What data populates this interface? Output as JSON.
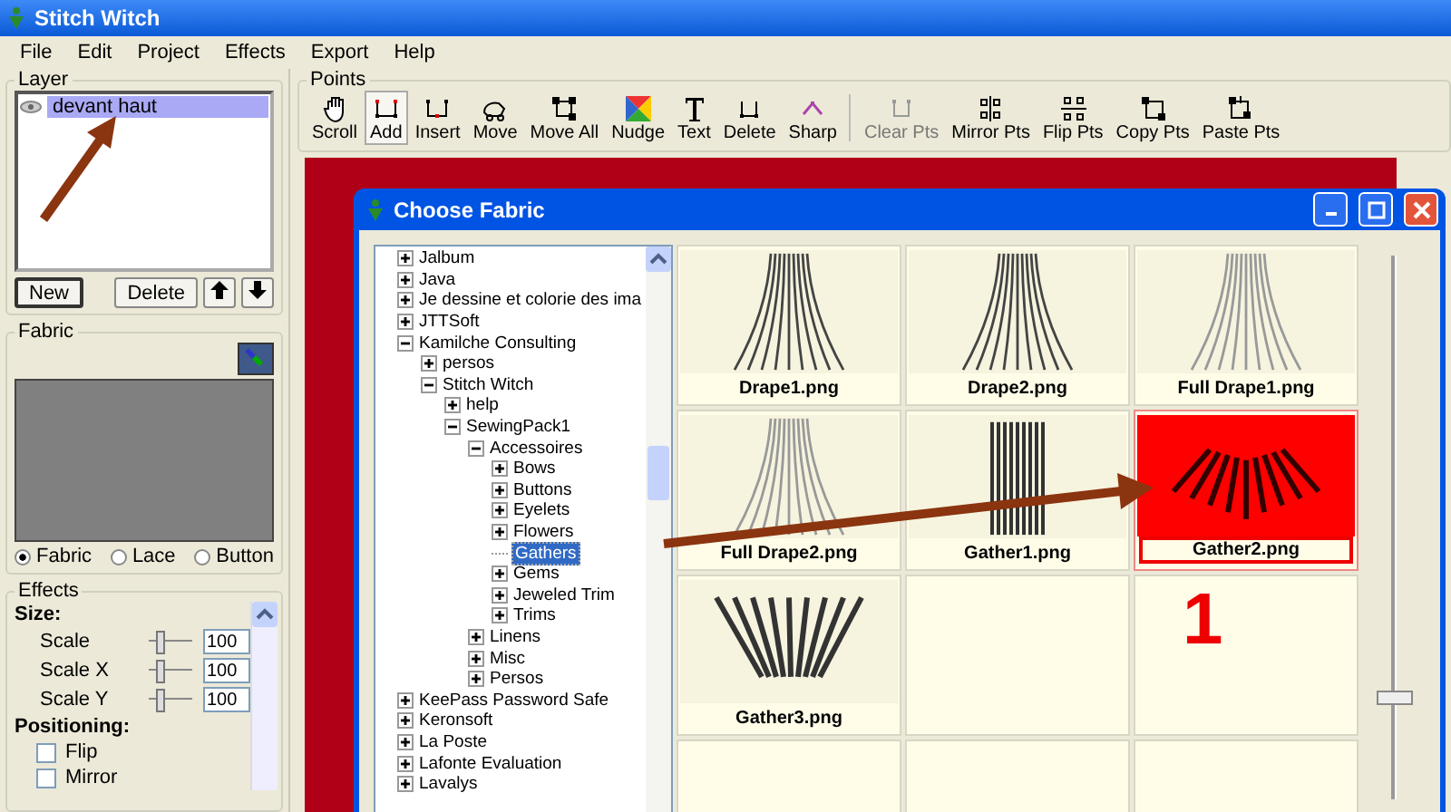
{
  "window": {
    "title": "Stitch Witch"
  },
  "menu": [
    "File",
    "Edit",
    "Project",
    "Effects",
    "Export",
    "Help"
  ],
  "layer_panel": {
    "title": "Layer",
    "layers": [
      {
        "name": "devant haut",
        "selected": true
      }
    ],
    "buttons": [
      "New",
      "Delete"
    ]
  },
  "fabric_panel": {
    "title": "Fabric",
    "types": [
      {
        "label": "Fabric",
        "selected": true
      },
      {
        "label": "Lace",
        "selected": false
      },
      {
        "label": "Button",
        "selected": false
      }
    ]
  },
  "effects_panel": {
    "title": "Effects",
    "sections": [
      {
        "heading": "Size:",
        "rows": [
          {
            "kind": "slider",
            "label": "Scale",
            "level": 0.25,
            "value": "100"
          },
          {
            "kind": "slider",
            "label": "Scale X",
            "level": 0.25,
            "value": "100"
          },
          {
            "kind": "slider",
            "label": "Scale Y",
            "level": 0.25,
            "value": "100"
          }
        ]
      },
      {
        "heading": "Positioning:",
        "rows": [
          {
            "kind": "checkbox",
            "label": "Flip",
            "checked": false
          },
          {
            "kind": "checkbox",
            "label": "Mirror",
            "checked": false
          }
        ]
      }
    ]
  },
  "toolbar": {
    "title": "Points",
    "tools": [
      {
        "kind": "hand",
        "label": "Scroll",
        "selected": false,
        "disabled": false
      },
      {
        "kind": "add",
        "label": "Add",
        "selected": true,
        "disabled": false
      },
      {
        "kind": "insert",
        "label": "Insert",
        "selected": false,
        "disabled": false
      },
      {
        "kind": "move",
        "label": "Move",
        "selected": false,
        "disabled": false
      },
      {
        "kind": "move-all",
        "label": "Move All",
        "selected": false,
        "disabled": false
      },
      {
        "kind": "nudge",
        "label": "Nudge",
        "selected": false,
        "disabled": false
      },
      {
        "kind": "text",
        "label": "Text",
        "selected": false,
        "disabled": false
      },
      {
        "kind": "delete",
        "label": "Delete",
        "selected": false,
        "disabled": false
      },
      {
        "kind": "sharp",
        "label": "Sharp",
        "selected": false,
        "disabled": false
      },
      {
        "kind": "clear",
        "label": "Clear Pts",
        "selected": false,
        "disabled": true
      },
      {
        "kind": "mirror",
        "label": "Mirror Pts",
        "selected": false,
        "disabled": false
      },
      {
        "kind": "flip",
        "label": "Flip Pts",
        "selected": false,
        "disabled": false
      },
      {
        "kind": "copy",
        "label": "Copy Pts",
        "selected": false,
        "disabled": false
      },
      {
        "kind": "paste",
        "label": "Paste Pts",
        "selected": false,
        "disabled": false
      }
    ]
  },
  "dialog": {
    "title": "Choose Fabric",
    "tree": [
      {
        "label": "Jalbum",
        "kind": "folder",
        "expanded": false,
        "selected": false
      },
      {
        "label": "Java",
        "kind": "folder",
        "expanded": false,
        "selected": false
      },
      {
        "label": "Je dessine et colorie des ima",
        "kind": "folder",
        "expanded": false,
        "selected": false
      },
      {
        "label": "JTTSoft",
        "kind": "folder",
        "expanded": false,
        "selected": false
      },
      {
        "label": "Kamilche Consulting",
        "kind": "folder",
        "expanded": true,
        "selected": false,
        "children": [
          {
            "label": "persos",
            "kind": "folder",
            "expanded": false,
            "selected": false
          },
          {
            "label": "Stitch Witch",
            "kind": "folder",
            "expanded": true,
            "selected": false,
            "children": [
              {
                "label": "help",
                "kind": "folder",
                "expanded": false,
                "selected": false
              },
              {
                "label": "SewingPack1",
                "kind": "folder",
                "expanded": true,
                "selected": false,
                "children": [
                  {
                    "label": "Accessoires",
                    "kind": "folder",
                    "expanded": true,
                    "selected": false,
                    "children": [
                      {
                        "label": "Bows",
                        "kind": "folder",
                        "expanded": false,
                        "selected": false
                      },
                      {
                        "label": "Buttons",
                        "kind": "folder",
                        "expanded": false,
                        "selected": false
                      },
                      {
                        "label": "Eyelets",
                        "kind": "folder",
                        "expanded": false,
                        "selected": false
                      },
                      {
                        "label": "Flowers",
                        "kind": "folder",
                        "expanded": false,
                        "selected": false
                      },
                      {
                        "label": "Gathers",
                        "kind": "item",
                        "selected": true
                      },
                      {
                        "label": "Gems",
                        "kind": "folder",
                        "expanded": false,
                        "selected": false
                      },
                      {
                        "label": "Jeweled Trim",
                        "kind": "folder",
                        "expanded": false,
                        "selected": false
                      },
                      {
                        "label": "Trims",
                        "kind": "folder",
                        "expanded": false,
                        "selected": false
                      }
                    ]
                  },
                  {
                    "label": "Linens",
                    "kind": "folder",
                    "expanded": false,
                    "selected": false
                  },
                  {
                    "label": "Misc",
                    "kind": "folder",
                    "expanded": false,
                    "selected": false
                  },
                  {
                    "label": "Persos",
                    "kind": "folder",
                    "expanded": false,
                    "selected": false
                  }
                ]
              }
            ]
          }
        ]
      },
      {
        "label": "KeePass Password Safe",
        "kind": "folder",
        "expanded": false,
        "selected": false
      },
      {
        "label": "Keronsoft",
        "kind": "folder",
        "expanded": false,
        "selected": false
      },
      {
        "label": "La Poste",
        "kind": "folder",
        "expanded": false,
        "selected": false
      },
      {
        "label": "Lafonte Evaluation",
        "kind": "folder",
        "expanded": false,
        "selected": false
      },
      {
        "label": "Lavalys",
        "kind": "folder",
        "expanded": false,
        "selected": false
      }
    ],
    "thumbnails": [
      {
        "kind": "drape",
        "label": "Drape1.png",
        "selected": false
      },
      {
        "kind": "drape",
        "label": "Drape2.png",
        "selected": false
      },
      {
        "kind": "full-drape",
        "label": "Full Drape1.png",
        "selected": false
      },
      {
        "kind": "full-drape",
        "label": "Full Drape2.png",
        "selected": false
      },
      {
        "kind": "gather",
        "label": "Gather1.png",
        "selected": false
      },
      {
        "kind": "fan",
        "label": "Gather2.png",
        "selected": true
      },
      {
        "kind": "wide-fan",
        "label": "Gather3.png",
        "selected": false
      },
      {
        "kind": "empty",
        "selected": false
      },
      {
        "kind": "empty",
        "selected": false
      },
      {
        "kind": "empty",
        "selected": false
      },
      {
        "kind": "empty",
        "selected": false
      },
      {
        "kind": "empty",
        "selected": false
      }
    ],
    "zoom_slider": {
      "level": 0.2
    }
  },
  "annotations": {
    "step_number": "1"
  }
}
